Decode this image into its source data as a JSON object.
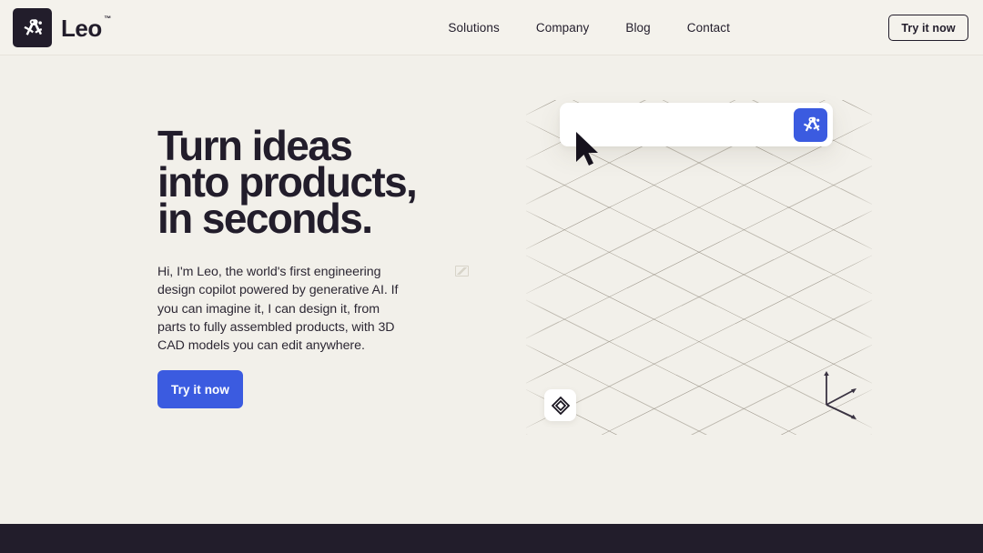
{
  "theme": {
    "background": "#f2f0ea",
    "header_background": "#f4f2ec",
    "ink": "#221d2b",
    "accent_blue": "#3b5be0",
    "grid_line": "#8c8578",
    "footer": "#221d2b"
  },
  "header": {
    "brand": {
      "name": "Leo",
      "trademark": "™",
      "logo_icon": "compass-logo-icon"
    },
    "nav_items": [
      {
        "label": "Solutions"
      },
      {
        "label": "Company"
      },
      {
        "label": "Blog"
      },
      {
        "label": "Contact"
      }
    ],
    "cta": {
      "label": "Try it now"
    }
  },
  "hero": {
    "headline": "Turn ideas\ninto products,\nin seconds.",
    "subcopy": "Hi, I'm Leo, the world's first engineering design copilot powered by generative AI. If you can imagine it, I can design it, from parts to fully assembled products, with 3D CAD models you can edit anywhere.",
    "cta": {
      "label": "Try it now"
    },
    "inline_image_placeholder": "broken-image-icon"
  },
  "scene": {
    "prompt": {
      "value": "",
      "placeholder": ""
    },
    "send_button": {
      "icon": "compass-send-icon"
    },
    "viewport_tool": {
      "icon": "isometric-cube-icon"
    },
    "axis_gizmo": {
      "icon": "3d-axis-gizmo-icon"
    },
    "cursor": {
      "icon": "mouse-pointer-icon"
    },
    "grid": {
      "style": "isometric",
      "spacing_px": 44
    }
  },
  "footer": {
    "label": ""
  }
}
